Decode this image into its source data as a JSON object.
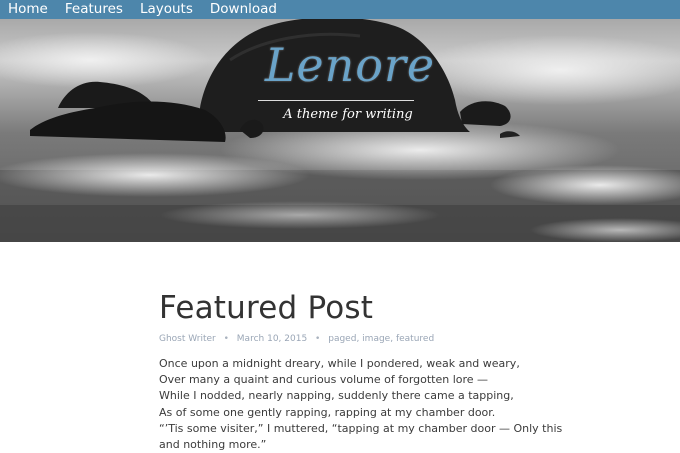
{
  "nav": {
    "items": [
      {
        "label": "Home"
      },
      {
        "label": "Features"
      },
      {
        "label": "Layouts"
      },
      {
        "label": "Download"
      }
    ]
  },
  "hero": {
    "title": "Lenore",
    "tagline": "A theme for writing"
  },
  "post": {
    "title": "Featured Post",
    "author": "Ghost Writer",
    "date": "March 10, 2015",
    "tags": [
      "paged",
      "image",
      "featured"
    ],
    "tag_separator": ", ",
    "meta_separator": "•",
    "lines": [
      "Once upon a midnight dreary, while I pondered, weak and weary,",
      "Over many a quaint and curious volume of forgotten lore —",
      "While I nodded, nearly napping, suddenly there came a tapping,",
      "As of some one gently rapping, rapping at my chamber door.",
      "“’Tis some visiter,” I muttered, “tapping at my chamber door — Only this",
      "and nothing more.”"
    ]
  },
  "colors": {
    "nav_background": "#4d86ab",
    "title_script": "#6aa3c8",
    "meta_text": "#9aa6b6"
  }
}
